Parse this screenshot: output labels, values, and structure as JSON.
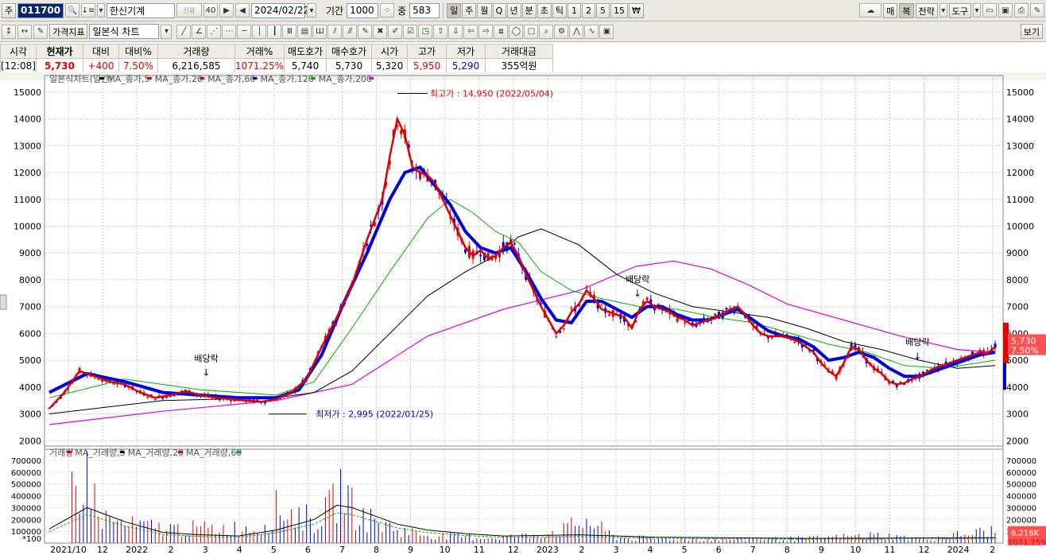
{
  "toolbar1": {
    "market_label": "주",
    "code": "011700",
    "name": "한신기계",
    "date": "2024/02/22",
    "period_label": "기간",
    "period_value": "1000",
    "count_label": "중",
    "count_value": "583",
    "period_buttons": [
      "일",
      "주",
      "월",
      "Q",
      "년",
      "분",
      "초",
      "틱",
      "1",
      "2",
      "5",
      "15",
      "₩"
    ],
    "right_buttons": [
      "매",
      "복",
      "전략",
      "도구"
    ]
  },
  "toolbar2": {
    "indicator_label": "가격지표",
    "chart_type": "일본식 차트",
    "view_button": "보기"
  },
  "quote": {
    "headers": [
      "시각",
      "현재가",
      "대비",
      "대비%",
      "거래량",
      "거래%",
      "매도호가",
      "매수호가",
      "시가",
      "고가",
      "저가",
      "거래대금"
    ],
    "values": [
      "[12:08]",
      "5,730",
      "+400",
      "7.50%",
      "6,216,585",
      "1071.25%",
      "5,740",
      "5,730",
      "5,320",
      "5,950",
      "5,290",
      "355억원"
    ]
  },
  "chart_data": {
    "type": "line",
    "price_legend": [
      "일본식차트(일간)",
      "MA_종가,5",
      "MA_종가,20",
      "MA_종가,60",
      "MA_종가,120",
      "MA_종가,200"
    ],
    "volume_legend": [
      "거래량",
      "MA_거래량,5",
      "MA_거래량,20",
      "MA_거래량,60"
    ],
    "ylim": [
      1800,
      15500
    ],
    "y_ticks": [
      2000,
      3000,
      4000,
      5000,
      6000,
      7000,
      8000,
      9000,
      10000,
      11000,
      12000,
      13000,
      14000,
      15000
    ],
    "vol_ylim": [
      0,
      780000
    ],
    "vol_ticks": [
      100000,
      200000,
      300000,
      400000,
      500000,
      600000,
      700000
    ],
    "x_labels": [
      "2021/10",
      "12",
      "2022",
      "2",
      "3",
      "4",
      "5",
      "6",
      "7",
      "8",
      "9",
      "10",
      "11",
      "12",
      "2023",
      "2",
      "3",
      "4",
      "5",
      "6",
      "7",
      "8",
      "9",
      "10",
      "11",
      "12",
      "2024",
      "2"
    ],
    "annotations": {
      "high": "최고가 : 14,950 (2022/05/04)",
      "low": "최저가 : 2,995 (2022/01/25)",
      "dividend": "배당락"
    },
    "last_price": "5,730",
    "last_change": "7.50%",
    "last_volume": "6,216K",
    "last_volume_pct": "1071.25%",
    "vol_scale_tag": "*100",
    "colors": {
      "ma5": "#e00000",
      "ma20": "#0000dd",
      "ma60": "#00b000",
      "ma120": "#000000",
      "ma200": "#e000e0"
    },
    "ma5": [
      [
        0,
        3200
      ],
      [
        4,
        3800
      ],
      [
        8,
        4600
      ],
      [
        12,
        4400
      ],
      [
        16,
        4200
      ],
      [
        20,
        4100
      ],
      [
        24,
        3800
      ],
      [
        28,
        3600
      ],
      [
        32,
        3700
      ],
      [
        36,
        3850
      ],
      [
        40,
        3700
      ],
      [
        44,
        3600
      ],
      [
        48,
        3550
      ],
      [
        52,
        3500
      ],
      [
        56,
        3450
      ],
      [
        60,
        3550
      ],
      [
        64,
        3800
      ],
      [
        68,
        4300
      ],
      [
        72,
        5500
      ],
      [
        76,
        6600
      ],
      [
        80,
        7800
      ],
      [
        84,
        9500
      ],
      [
        88,
        11000
      ],
      [
        90,
        12600
      ],
      [
        92,
        14000
      ],
      [
        94,
        13400
      ],
      [
        96,
        12200
      ],
      [
        98,
        12000
      ],
      [
        100,
        11900
      ],
      [
        102,
        11600
      ],
      [
        104,
        11000
      ],
      [
        106,
        10400
      ],
      [
        108,
        9800
      ],
      [
        110,
        9200
      ],
      [
        112,
        8900
      ],
      [
        114,
        9100
      ],
      [
        116,
        8800
      ],
      [
        118,
        8900
      ],
      [
        120,
        9200
      ],
      [
        122,
        9400
      ],
      [
        124,
        8900
      ],
      [
        126,
        8200
      ],
      [
        128,
        7600
      ],
      [
        130,
        7000
      ],
      [
        132,
        6500
      ],
      [
        134,
        6000
      ],
      [
        136,
        6300
      ],
      [
        138,
        6800
      ],
      [
        140,
        7100
      ],
      [
        142,
        7600
      ],
      [
        144,
        7300
      ],
      [
        146,
        6900
      ],
      [
        148,
        6800
      ],
      [
        150,
        6700
      ],
      [
        152,
        6600
      ],
      [
        154,
        6200
      ],
      [
        156,
        6900
      ],
      [
        158,
        7200
      ],
      [
        160,
        7000
      ],
      [
        162,
        6900
      ],
      [
        164,
        6800
      ],
      [
        166,
        6600
      ],
      [
        168,
        6500
      ],
      [
        170,
        6300
      ],
      [
        172,
        6400
      ],
      [
        174,
        6500
      ],
      [
        176,
        6600
      ],
      [
        178,
        6700
      ],
      [
        180,
        6900
      ],
      [
        182,
        7000
      ],
      [
        184,
        6700
      ],
      [
        186,
        6300
      ],
      [
        188,
        6000
      ],
      [
        190,
        5900
      ],
      [
        192,
        5900
      ],
      [
        194,
        5900
      ],
      [
        196,
        5800
      ],
      [
        198,
        5700
      ],
      [
        200,
        5500
      ],
      [
        202,
        5300
      ],
      [
        204,
        4900
      ],
      [
        206,
        4600
      ],
      [
        208,
        4400
      ],
      [
        210,
        4900
      ],
      [
        212,
        5500
      ],
      [
        214,
        5400
      ],
      [
        216,
        5000
      ],
      [
        218,
        4700
      ],
      [
        220,
        4500
      ],
      [
        222,
        4200
      ],
      [
        224,
        4100
      ],
      [
        226,
        4150
      ],
      [
        228,
        4300
      ],
      [
        230,
        4400
      ],
      [
        232,
        4550
      ],
      [
        234,
        4700
      ],
      [
        236,
        4800
      ],
      [
        238,
        4900
      ],
      [
        240,
        5000
      ],
      [
        242,
        5100
      ],
      [
        244,
        5200
      ],
      [
        246,
        5300
      ],
      [
        248,
        5250
      ],
      [
        250,
        5500
      ]
    ],
    "ma20": [
      [
        0,
        3800
      ],
      [
        10,
        4500
      ],
      [
        20,
        4200
      ],
      [
        30,
        3800
      ],
      [
        40,
        3700
      ],
      [
        50,
        3600
      ],
      [
        60,
        3600
      ],
      [
        66,
        3900
      ],
      [
        72,
        5200
      ],
      [
        78,
        7200
      ],
      [
        84,
        9000
      ],
      [
        90,
        11000
      ],
      [
        94,
        12000
      ],
      [
        98,
        12200
      ],
      [
        102,
        11500
      ],
      [
        106,
        10800
      ],
      [
        110,
        9800
      ],
      [
        114,
        9200
      ],
      [
        118,
        9000
      ],
      [
        122,
        9200
      ],
      [
        126,
        8300
      ],
      [
        130,
        7300
      ],
      [
        134,
        6500
      ],
      [
        138,
        6400
      ],
      [
        142,
        7200
      ],
      [
        146,
        7200
      ],
      [
        150,
        6900
      ],
      [
        154,
        6600
      ],
      [
        158,
        7000
      ],
      [
        162,
        7000
      ],
      [
        166,
        6700
      ],
      [
        170,
        6500
      ],
      [
        174,
        6500
      ],
      [
        178,
        6700
      ],
      [
        182,
        6900
      ],
      [
        186,
        6500
      ],
      [
        190,
        6100
      ],
      [
        194,
        5900
      ],
      [
        198,
        5800
      ],
      [
        202,
        5500
      ],
      [
        206,
        5000
      ],
      [
        210,
        5100
      ],
      [
        214,
        5300
      ],
      [
        218,
        5100
      ],
      [
        222,
        4700
      ],
      [
        226,
        4400
      ],
      [
        230,
        4400
      ],
      [
        234,
        4600
      ],
      [
        238,
        4800
      ],
      [
        242,
        5000
      ],
      [
        246,
        5200
      ],
      [
        250,
        5300
      ]
    ],
    "ma60": [
      [
        0,
        3600
      ],
      [
        20,
        4300
      ],
      [
        40,
        3900
      ],
      [
        60,
        3700
      ],
      [
        70,
        4200
      ],
      [
        80,
        6200
      ],
      [
        90,
        8300
      ],
      [
        100,
        10300
      ],
      [
        106,
        11000
      ],
      [
        112,
        10500
      ],
      [
        118,
        9800
      ],
      [
        124,
        9400
      ],
      [
        130,
        8300
      ],
      [
        138,
        7600
      ],
      [
        146,
        7300
      ],
      [
        156,
        7000
      ],
      [
        166,
        6900
      ],
      [
        176,
        6600
      ],
      [
        186,
        6400
      ],
      [
        196,
        6000
      ],
      [
        206,
        5600
      ],
      [
        216,
        5300
      ],
      [
        226,
        4800
      ],
      [
        236,
        4700
      ],
      [
        250,
        5000
      ]
    ],
    "ma120": [
      [
        0,
        3000
      ],
      [
        30,
        3500
      ],
      [
        60,
        3600
      ],
      [
        70,
        3800
      ],
      [
        80,
        4600
      ],
      [
        90,
        6000
      ],
      [
        100,
        7400
      ],
      [
        110,
        8300
      ],
      [
        118,
        8900
      ],
      [
        124,
        9600
      ],
      [
        130,
        9900
      ],
      [
        140,
        9300
      ],
      [
        150,
        8200
      ],
      [
        160,
        7500
      ],
      [
        170,
        7000
      ],
      [
        180,
        6800
      ],
      [
        190,
        6600
      ],
      [
        200,
        6200
      ],
      [
        210,
        5700
      ],
      [
        220,
        5400
      ],
      [
        230,
        5000
      ],
      [
        240,
        4700
      ],
      [
        250,
        4800
      ]
    ],
    "ma200": [
      [
        0,
        2600
      ],
      [
        30,
        3100
      ],
      [
        60,
        3500
      ],
      [
        80,
        4100
      ],
      [
        100,
        5900
      ],
      [
        120,
        6900
      ],
      [
        140,
        7600
      ],
      [
        155,
        8500
      ],
      [
        165,
        8700
      ],
      [
        175,
        8400
      ],
      [
        185,
        7800
      ],
      [
        195,
        7100
      ],
      [
        210,
        6500
      ],
      [
        225,
        5900
      ],
      [
        240,
        5400
      ],
      [
        250,
        5300
      ]
    ],
    "volume_peaks": [
      [
        6,
        650000
      ],
      [
        9,
        700000
      ],
      [
        11,
        720000
      ],
      [
        13,
        300000
      ],
      [
        20,
        200000
      ],
      [
        34,
        160000
      ],
      [
        56,
        170000
      ],
      [
        60,
        380000
      ],
      [
        66,
        320000
      ],
      [
        70,
        240000
      ],
      [
        72,
        300000
      ],
      [
        74,
        380000
      ],
      [
        76,
        520000
      ],
      [
        78,
        690000
      ],
      [
        80,
        400000
      ],
      [
        82,
        320000
      ],
      [
        84,
        270000
      ],
      [
        86,
        250000
      ],
      [
        88,
        200000
      ],
      [
        90,
        180000
      ],
      [
        92,
        150000
      ],
      [
        96,
        120000
      ],
      [
        100,
        90000
      ],
      [
        104,
        80000
      ],
      [
        110,
        70000
      ],
      [
        118,
        60000
      ],
      [
        126,
        80000
      ],
      [
        136,
        150000
      ],
      [
        142,
        250000
      ],
      [
        150,
        60000
      ],
      [
        160,
        50000
      ],
      [
        180,
        40000
      ],
      [
        200,
        50000
      ],
      [
        220,
        90000
      ],
      [
        230,
        40000
      ],
      [
        250,
        140000
      ]
    ],
    "vol_ma": [
      [
        0,
        120000
      ],
      [
        10,
        300000
      ],
      [
        20,
        180000
      ],
      [
        30,
        90000
      ],
      [
        40,
        70000
      ],
      [
        50,
        60000
      ],
      [
        60,
        110000
      ],
      [
        70,
        200000
      ],
      [
        76,
        320000
      ],
      [
        80,
        300000
      ],
      [
        86,
        230000
      ],
      [
        92,
        160000
      ],
      [
        100,
        110000
      ],
      [
        110,
        80000
      ],
      [
        120,
        60000
      ],
      [
        140,
        70000
      ],
      [
        160,
        50000
      ],
      [
        200,
        40000
      ],
      [
        250,
        45000
      ]
    ]
  }
}
